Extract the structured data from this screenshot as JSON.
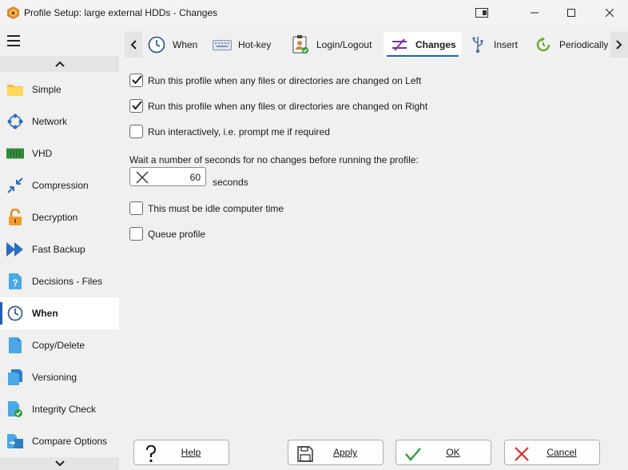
{
  "window": {
    "title": "Profile Setup: large external HDDs - Changes"
  },
  "sidebar": {
    "items": [
      {
        "label": "Simple",
        "icon": "folder-icon"
      },
      {
        "label": "Network",
        "icon": "network-icon"
      },
      {
        "label": "VHD",
        "icon": "vhd-icon"
      },
      {
        "label": "Compression",
        "icon": "compression-icon"
      },
      {
        "label": "Decryption",
        "icon": "unlock-icon"
      },
      {
        "label": "Fast Backup",
        "icon": "fast-forward-icon"
      },
      {
        "label": "Decisions - Files",
        "icon": "decisions-icon"
      },
      {
        "label": "When",
        "icon": "clock-icon",
        "active": true
      },
      {
        "label": "Copy/Delete",
        "icon": "copy-icon"
      },
      {
        "label": "Versioning",
        "icon": "versioning-icon"
      },
      {
        "label": "Integrity Check",
        "icon": "integrity-icon"
      },
      {
        "label": "Compare Options",
        "icon": "compare-icon"
      }
    ]
  },
  "tabs": [
    {
      "label": "When",
      "icon": "clock-icon"
    },
    {
      "label": "Hot-key",
      "icon": "keyboard-icon"
    },
    {
      "label": "Login/Logout",
      "icon": "login-icon"
    },
    {
      "label": "Changes",
      "icon": "changes-icon",
      "active": true
    },
    {
      "label": "Insert",
      "icon": "usb-icon"
    },
    {
      "label": "Periodically",
      "icon": "refresh-icon"
    }
  ],
  "options": {
    "run_on_left": {
      "label": "Run this profile when any files or directories are changed on Left",
      "checked": true
    },
    "run_on_right": {
      "label": "Run this profile when any files or directories are changed on Right",
      "checked": true
    },
    "run_interactively": {
      "label": "Run interactively, i.e. prompt me if required",
      "checked": false
    },
    "wait_label": "Wait a number of seconds for no changes before running the profile:",
    "wait_seconds": "60",
    "seconds_label": "seconds",
    "idle_time": {
      "label": "This must be idle computer time",
      "checked": false
    },
    "queue_profile": {
      "label": "Queue profile",
      "checked": false
    }
  },
  "buttons": {
    "help": "Help",
    "apply": "Apply",
    "ok": "OK",
    "cancel": "Cancel"
  },
  "colors": {
    "accent": "#1f5fb3",
    "changes_icon": "#7b2fa8",
    "ok_green": "#2e9e3a",
    "cancel_red": "#d9302c"
  }
}
